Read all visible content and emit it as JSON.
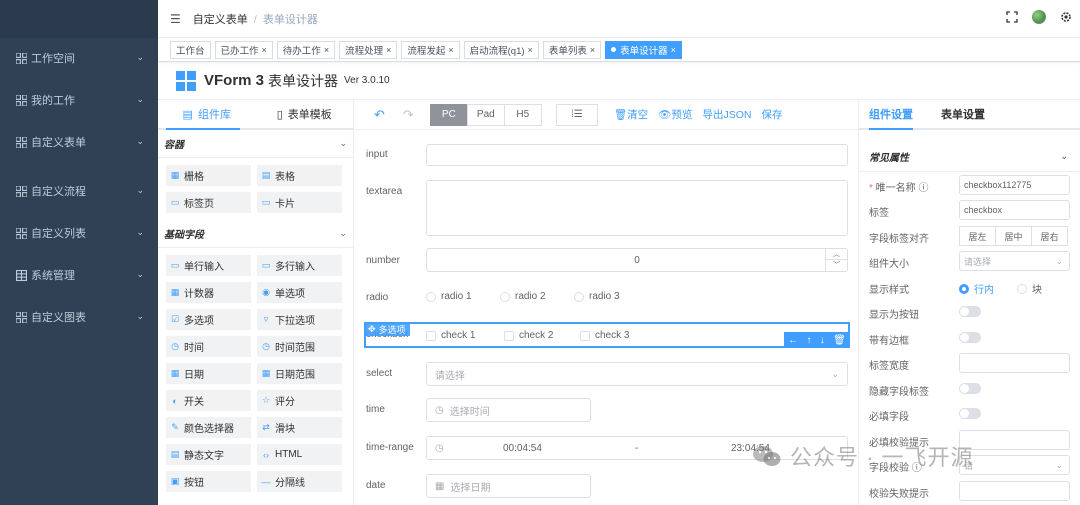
{
  "sidebar": {
    "items": [
      {
        "label": "工作空间",
        "icon": "grid-icon"
      },
      {
        "label": "我的工作",
        "icon": "grid-icon"
      },
      {
        "label": "自定义表单",
        "icon": "grid-icon"
      },
      {
        "label": "自定义流程",
        "icon": "grid-icon"
      },
      {
        "label": "自定义列表",
        "icon": "grid-icon"
      },
      {
        "label": "系统管理",
        "icon": "table-icon"
      },
      {
        "label": "自定义图表",
        "icon": "grid-icon"
      }
    ]
  },
  "header": {
    "breadcrumb_root": "自定义表单",
    "breadcrumb_sep": "/",
    "breadcrumb_current": "表单设计器"
  },
  "tags": [
    {
      "label": "工作台",
      "closable": false,
      "active": false
    },
    {
      "label": "已办工作",
      "closable": true,
      "active": false
    },
    {
      "label": "待办工作",
      "closable": true,
      "active": false
    },
    {
      "label": "流程处理",
      "closable": true,
      "active": false
    },
    {
      "label": "流程发起",
      "closable": true,
      "active": false
    },
    {
      "label": "启动流程(q1)",
      "closable": true,
      "active": false
    },
    {
      "label": "表单列表",
      "closable": true,
      "active": false
    },
    {
      "label": "表单设计器",
      "closable": true,
      "active": true
    }
  ],
  "vform": {
    "title": "VForm 3",
    "subtitle": "表单设计器",
    "version": "Ver 3.0.10"
  },
  "widget_panel": {
    "tabs": [
      "组件库",
      "表单模板"
    ],
    "container_group": "容器",
    "containers": [
      "栅格",
      "表格",
      "标签页",
      "卡片"
    ],
    "basic_group": "基础字段",
    "basics": [
      "单行输入",
      "多行输入",
      "计数器",
      "单选项",
      "多选项",
      "下拉选项",
      "时间",
      "时间范围",
      "日期",
      "日期范围",
      "开关",
      "评分",
      "颜色选择器",
      "滑块",
      "静态文字",
      "HTML",
      "按钮",
      "分隔线"
    ]
  },
  "toolbar": {
    "devices": [
      "PC",
      "Pad",
      "H5"
    ],
    "active_device": "PC",
    "clear": "清空",
    "preview": "预览",
    "export_json": "导出JSON",
    "save": "保存"
  },
  "canvas": {
    "input_label": "input",
    "textarea_label": "textarea",
    "number_label": "number",
    "number_value": "0",
    "radio_label": "radio",
    "radio_options": [
      "radio 1",
      "radio 2",
      "radio 3"
    ],
    "checkbox_label": "checkbox",
    "checkbox_options": [
      "check 1",
      "check 2",
      "check 3"
    ],
    "drag_hint": "多选项",
    "select_label": "select",
    "select_placeholder": "请选择",
    "time_label": "time",
    "time_placeholder": "选择时间",
    "time_range_label": "time-range",
    "time_range_start": "00:04:54",
    "time_range_sep": "-",
    "time_range_end": "23:04:54",
    "date_label": "date",
    "date_placeholder": "选择日期"
  },
  "settings": {
    "tabs": [
      "组件设置",
      "表单设置"
    ],
    "section": "常见属性",
    "rows": {
      "unique_name_label": "唯一名称",
      "unique_name_value": "checkbox112775",
      "label_label": "标签",
      "label_value": "checkbox",
      "align_label": "字段标签对齐",
      "align_options": [
        "居左",
        "居中",
        "居右"
      ],
      "size_label": "组件大小",
      "size_placeholder": "请选择",
      "display_label": "显示样式",
      "display_options": [
        "行内",
        "块"
      ],
      "as_button_label": "显示为按钮",
      "border_label": "带有边框",
      "label_width_label": "标签宽度",
      "hide_label_label": "隐藏字段标签",
      "required_label": "必填字段",
      "required_hint_label": "必填校验提示",
      "validation_label": "字段校验",
      "validation_placeholder": "请",
      "validation_fail_label": "校验失败提示"
    }
  },
  "watermark": {
    "text": "公众号 · 一飞开源"
  },
  "colors": {
    "primary": "#409eff",
    "sidebar_bg": "#304156"
  }
}
